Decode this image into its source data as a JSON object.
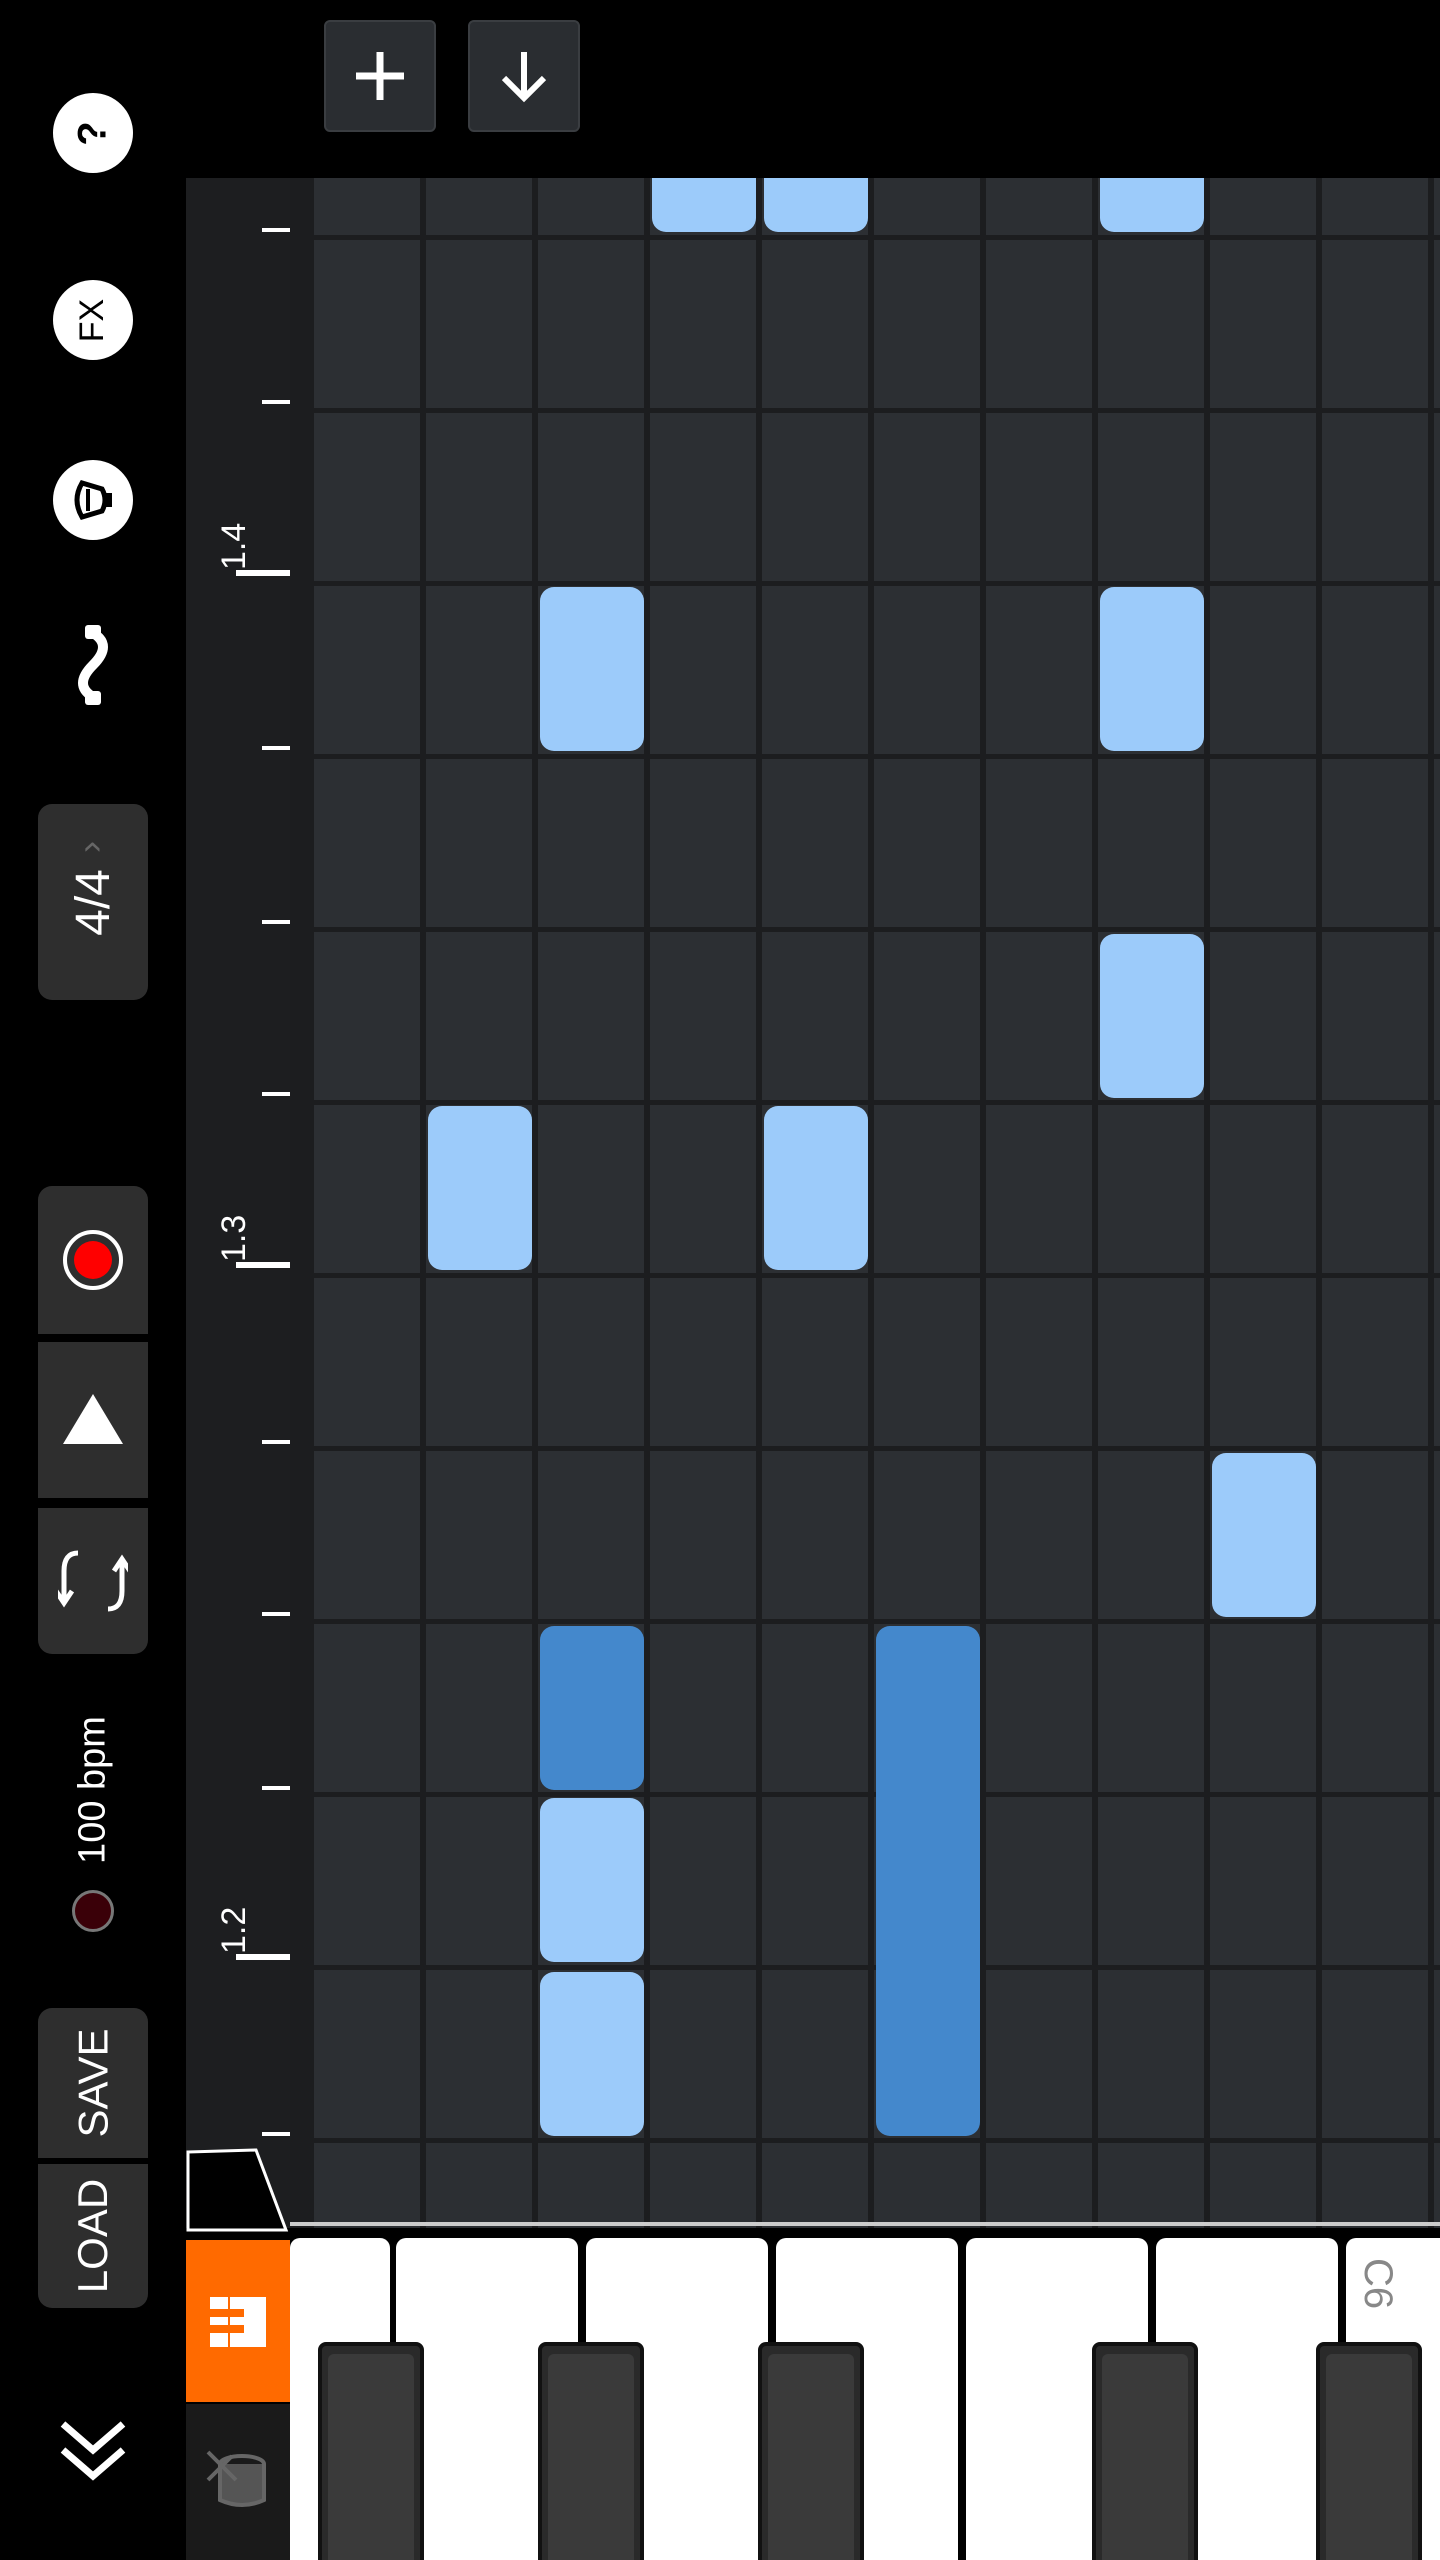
{
  "toolbar": {
    "add_icon": "plus-icon",
    "down_icon": "arrow-down-icon"
  },
  "sidebar": {
    "help_label": "?",
    "fx_label": "FX",
    "instrument_icon": "bell-icon",
    "cable_icon": "cable-icon",
    "time_signature": "4/4",
    "record_icon": "record-icon",
    "play_icon": "play-icon",
    "loop_icon": "loop-icon",
    "tempo": "100 bpm",
    "save_label": "SAVE",
    "load_label": "LOAD",
    "collapse_icon": "double-chevron-down-icon"
  },
  "ruler": {
    "labels": [
      "1.4",
      "1.3",
      "1.2"
    ]
  },
  "keyboard": {
    "octave_label": "C6",
    "piano_tab_icon": "piano-icon",
    "drum_tab_icon": "drum-icon"
  },
  "colors": {
    "accent": "#ff6a00",
    "note_light": "#9ccbfa",
    "note_selected": "#4488cc",
    "record": "#ff0000"
  }
}
